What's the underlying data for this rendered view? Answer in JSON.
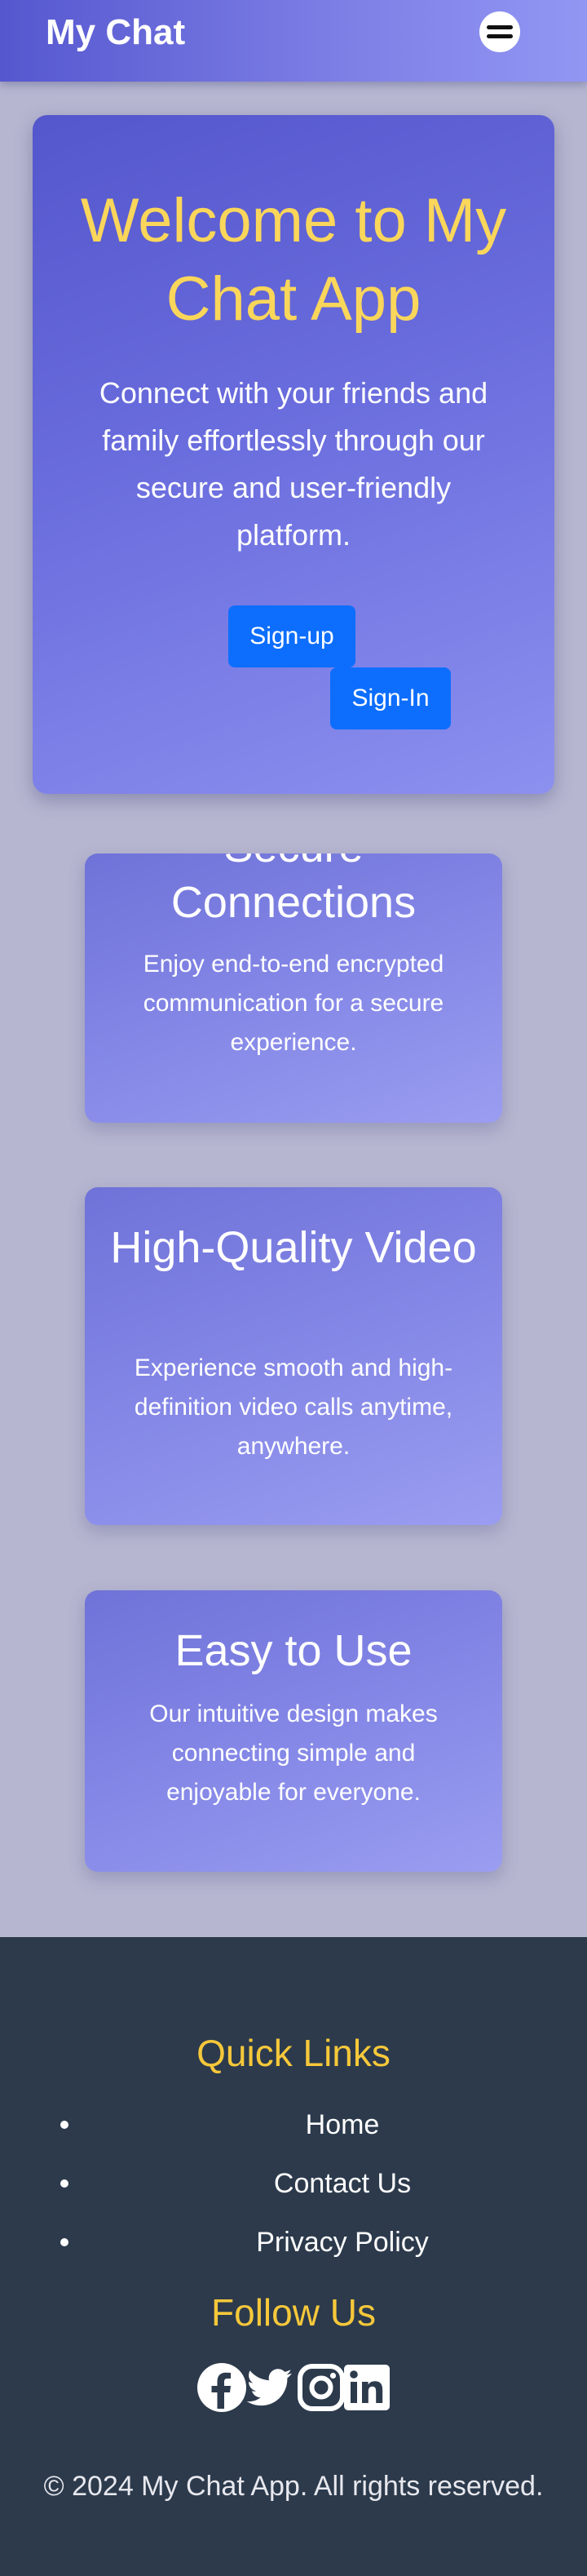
{
  "navbar": {
    "brand": "My Chat",
    "menu_icon": "hamburger-icon"
  },
  "hero": {
    "title": "Welcome to My Chat App",
    "description": "Connect with your friends and family effortlessly through our secure and user-friendly platform.",
    "signup_label": "Sign-up",
    "signin_label": "Sign-In"
  },
  "features": [
    {
      "title": "Secure Connections",
      "text": "Enjoy end-to-end encrypted communication for a secure experience."
    },
    {
      "title": "High-Quality Video",
      "text": "Experience smooth and high-definition video calls anytime, anywhere."
    },
    {
      "title": "Easy to Use",
      "text": "Our intuitive design makes connecting simple and enjoyable for everyone."
    }
  ],
  "footer": {
    "quick_links_title": "Quick Links",
    "links": [
      "Home",
      "Contact Us",
      "Privacy Policy"
    ],
    "follow_title": "Follow Us",
    "social_icons": [
      "facebook-icon",
      "twitter-icon",
      "instagram-icon",
      "linkedin-icon"
    ],
    "copyright": "© 2024 My Chat App. All rights reserved."
  },
  "colors": {
    "accent_yellow": "#fad65a",
    "button_blue": "#0d6efd",
    "footer_bg": "#2c3a4c",
    "page_bg": "#b6b6d0"
  }
}
